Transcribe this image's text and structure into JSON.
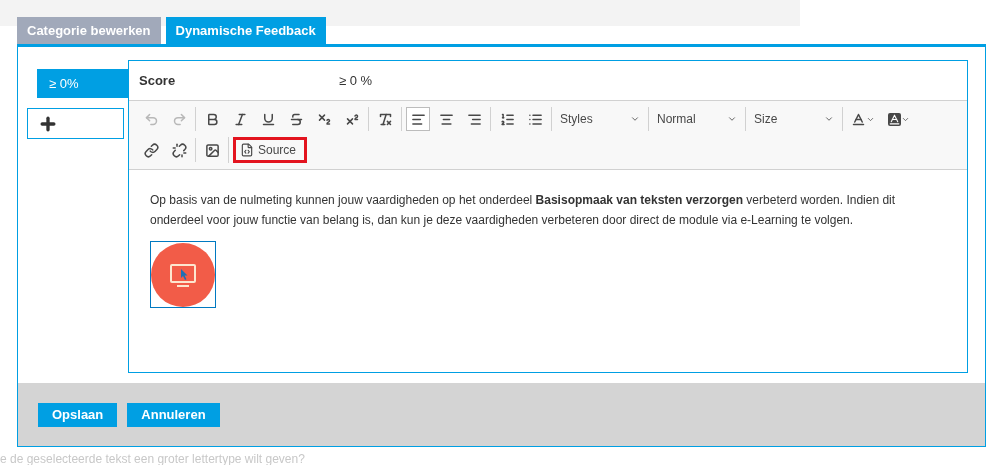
{
  "background": {
    "text": "e de geselecteerde tekst een groter lettertype wilt geven?"
  },
  "tabs": [
    {
      "label": "Categorie bewerken",
      "selected": false
    },
    {
      "label": "Dynamische Feedback",
      "selected": true
    }
  ],
  "ranges": [
    {
      "label": "≥ 0%",
      "selected": true
    }
  ],
  "editor": {
    "score_label": "Score",
    "score_value": "≥ 0 %",
    "toolbar_rows": [
      [
        [
          {
            "kind": "icon",
            "disabled": true,
            "selected": false
          },
          {
            "kind": "icon",
            "disabled": true,
            "selected": false
          }
        ],
        [
          {
            "kind": "icon",
            "disabled": false,
            "selected": false
          },
          {
            "kind": "icon",
            "disabled": false,
            "selected": false
          },
          {
            "kind": "icon",
            "disabled": false,
            "selected": false
          },
          {
            "kind": "icon",
            "disabled": false,
            "selected": false
          },
          {
            "kind": "icon",
            "disabled": false,
            "selected": false
          },
          {
            "kind": "icon",
            "disabled": false,
            "selected": false
          }
        ],
        [
          {
            "kind": "icon",
            "disabled": false,
            "selected": false
          }
        ],
        [
          {
            "kind": "icon",
            "disabled": false,
            "selected": true
          },
          {
            "kind": "icon",
            "disabled": false,
            "selected": false
          },
          {
            "kind": "icon",
            "disabled": false,
            "selected": false
          }
        ],
        [
          {
            "kind": "icon",
            "disabled": false,
            "selected": false
          },
          {
            "kind": "icon",
            "disabled": false,
            "selected": false
          }
        ],
        [
          {
            "kind": "combo",
            "label": "Styles"
          }
        ],
        [
          {
            "kind": "combo",
            "label": "Normal"
          }
        ],
        [
          {
            "kind": "combo",
            "label": "Size"
          }
        ],
        [
          {
            "kind": "icon",
            "disabled": false,
            "selected": false
          },
          {
            "kind": "icon",
            "disabled": false,
            "selected": false
          }
        ]
      ],
      [
        [
          {
            "kind": "icon",
            "disabled": false,
            "selected": false
          },
          {
            "kind": "icon",
            "disabled": false,
            "selected": false
          }
        ],
        [
          {
            "kind": "icon",
            "disabled": false,
            "selected": false
          }
        ],
        [
          {
            "kind": "text",
            "label": "Source",
            "highlighted": true
          }
        ]
      ]
    ],
    "paragraph": "Op basis van de nulmeting kunnen jouw vaardigheden op het onderdeel **Basisopmaak van teksten verzorgen** verbeterd worden. Indien dit onderdeel voor jouw functie van belang is, dan kun je deze vaardigheden verbeteren door direct de module via e-Learning te volgen."
  },
  "buttons": [
    {
      "label": "Opslaan"
    },
    {
      "label": "Annuleren"
    }
  ]
}
